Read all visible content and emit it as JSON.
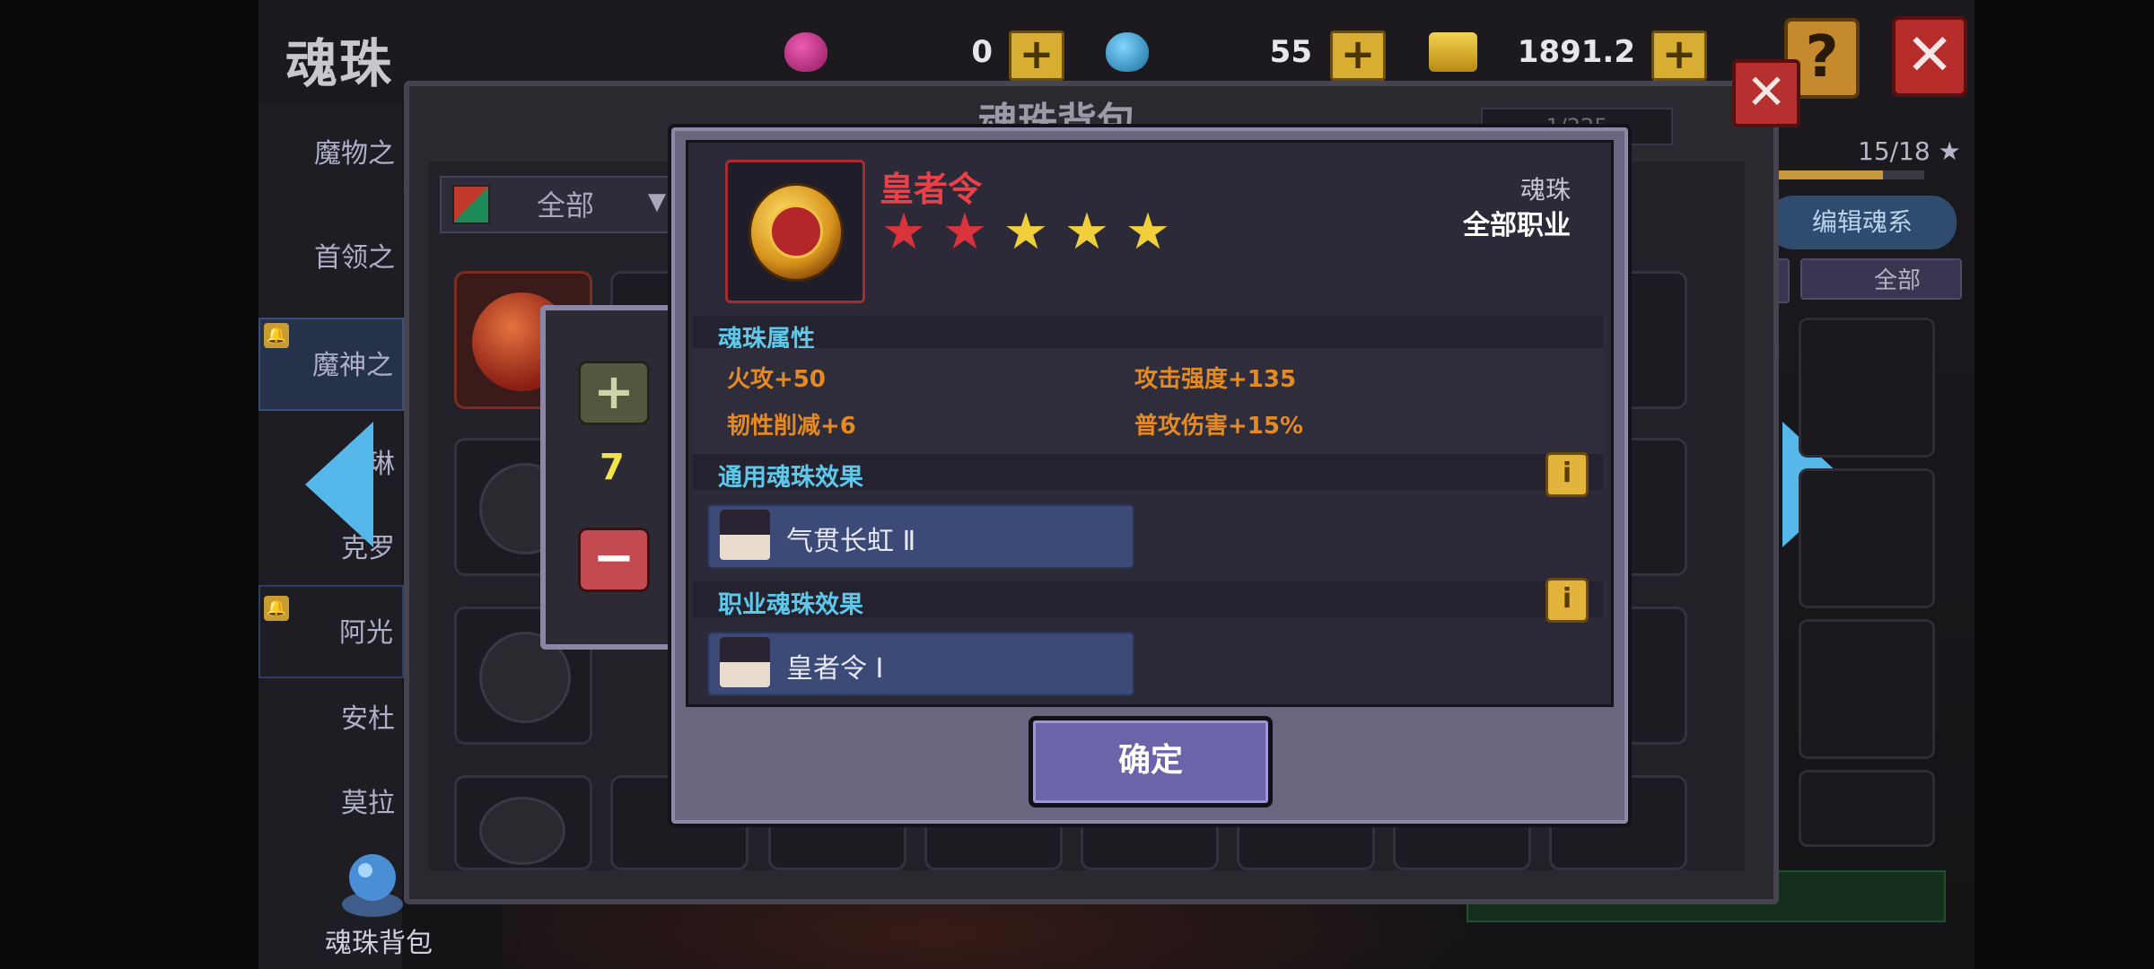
{
  "header": {
    "title": "魂珠",
    "currencies": [
      {
        "icon": "purple-gem-icon",
        "value": "0",
        "color": "#c02a86"
      },
      {
        "icon": "blue-gem-icon",
        "value": "55",
        "color": "#3aa3d6"
      },
      {
        "icon": "gold-coin-icon",
        "value": "1891.2万",
        "color": "#d4a81f"
      }
    ],
    "help_label": "?",
    "close_label": "✕",
    "add_label": "+"
  },
  "side_menu": {
    "items": [
      {
        "label": "魔物之"
      },
      {
        "label": "首领之"
      },
      {
        "label": "魔神之"
      },
      {
        "label": "琳"
      },
      {
        "label": "克罗"
      },
      {
        "label": "阿光"
      },
      {
        "label": "安杜"
      },
      {
        "label": "莫拉"
      }
    ],
    "lock_label": "🔔",
    "bag_label": "魂珠背包"
  },
  "right_panel": {
    "progress_text": "15/18 ★",
    "progress_value": 0.73,
    "edit_label": "编辑魂系",
    "filter_label": "全部"
  },
  "bag": {
    "title": "魂珠背包",
    "count": "1/225",
    "filter_label": "全部",
    "close_label": "✕"
  },
  "quantity": {
    "plus": "+",
    "value": "7",
    "minus": "−"
  },
  "dialog": {
    "item_name": "皇者令",
    "stars": {
      "total": 5,
      "red": 2
    },
    "star_glyph": "★",
    "type": "魂珠",
    "class": "全部职业",
    "attr_title": "魂珠属性",
    "attributes": [
      "火攻+50",
      "攻击强度+135",
      "韧性削减+6",
      "普攻伤害+15%"
    ],
    "common_title": "通用魂珠效果",
    "common_effect": "气贯长虹 Ⅱ",
    "class_title": "职业魂珠效果",
    "class_effect": "皇者令 Ⅰ",
    "info_label": "i",
    "confirm_label": "确定"
  }
}
